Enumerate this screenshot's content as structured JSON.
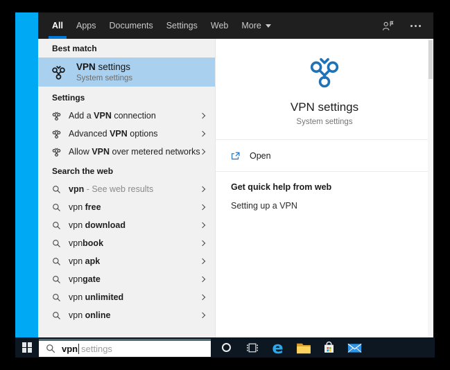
{
  "colors": {
    "accent": "#0078d7",
    "best_match_highlight": "#a9d0ee",
    "header_bg": "#1f1f1f",
    "left_panel_bg": "#f1f1f1",
    "taskbar_bg": "#0c1722",
    "desktop_strip_blue": "#00a9f3",
    "vpn_icon_blue": "#1e73b8",
    "small_icon_dark": "#333333",
    "edge_blue": "#2da8e8"
  },
  "header": {
    "tabs": [
      {
        "label": "All",
        "active": true
      },
      {
        "label": "Apps",
        "active": false
      },
      {
        "label": "Documents",
        "active": false
      },
      {
        "label": "Settings",
        "active": false
      },
      {
        "label": "Web",
        "active": false
      },
      {
        "label": "More",
        "active": false,
        "dropdown": true
      }
    ],
    "right_icons": [
      "feedback-icon",
      "ellipsis-icon"
    ]
  },
  "left_panel": {
    "best_match": {
      "section_label": "Best match",
      "icon": "vpn-icon",
      "title_parts": [
        {
          "t": "VPN",
          "b": true
        },
        {
          "t": " settings",
          "b": false
        }
      ],
      "subtitle": "System settings"
    },
    "sections": [
      {
        "label": "Settings",
        "items": [
          {
            "icon": "vpn-icon",
            "parts": [
              {
                "t": "Add a ",
                "b": false
              },
              {
                "t": "VPN",
                "b": true
              },
              {
                "t": " connection",
                "b": false
              }
            ]
          },
          {
            "icon": "vpn-icon",
            "parts": [
              {
                "t": "Advanced ",
                "b": false
              },
              {
                "t": "VPN",
                "b": true
              },
              {
                "t": " options",
                "b": false
              }
            ]
          },
          {
            "icon": "vpn-icon",
            "parts": [
              {
                "t": "Allow ",
                "b": false
              },
              {
                "t": "VPN",
                "b": true
              },
              {
                "t": " over metered networks",
                "b": false
              }
            ]
          }
        ]
      },
      {
        "label": "Search the web",
        "items": [
          {
            "icon": "search-icon",
            "parts": [
              {
                "t": "vpn",
                "b": true
              },
              {
                "t": " - See web results",
                "b": false,
                "muted": true
              }
            ]
          },
          {
            "icon": "search-icon",
            "parts": [
              {
                "t": "vpn ",
                "b": false
              },
              {
                "t": "free",
                "b": true
              }
            ]
          },
          {
            "icon": "search-icon",
            "parts": [
              {
                "t": "vpn ",
                "b": false
              },
              {
                "t": "download",
                "b": true
              }
            ]
          },
          {
            "icon": "search-icon",
            "parts": [
              {
                "t": "vpn",
                "b": false
              },
              {
                "t": "book",
                "b": true
              }
            ]
          },
          {
            "icon": "search-icon",
            "parts": [
              {
                "t": "vpn ",
                "b": false
              },
              {
                "t": "apk",
                "b": true
              }
            ]
          },
          {
            "icon": "search-icon",
            "parts": [
              {
                "t": "vpn",
                "b": false
              },
              {
                "t": "gate",
                "b": true
              }
            ]
          },
          {
            "icon": "search-icon",
            "parts": [
              {
                "t": "vpn ",
                "b": false
              },
              {
                "t": "unlimited",
                "b": true
              }
            ]
          },
          {
            "icon": "search-icon",
            "parts": [
              {
                "t": "vpn ",
                "b": false
              },
              {
                "t": "online",
                "b": true
              }
            ]
          }
        ]
      }
    ]
  },
  "right_panel": {
    "icon": "vpn-icon",
    "title": "VPN settings",
    "subtitle": "System settings",
    "open_icon": "open-in-new-window-icon",
    "open_label": "Open",
    "help_header": "Get quick help from web",
    "help_link": "Setting up a VPN"
  },
  "taskbar": {
    "search_typed": "vpn",
    "search_suggestion": "settings",
    "icons": [
      "windows-start-icon",
      "search-icon",
      "cortana-icon",
      "task-view-icon",
      "edge-icon",
      "file-explorer-icon",
      "store-icon",
      "mail-icon"
    ]
  }
}
